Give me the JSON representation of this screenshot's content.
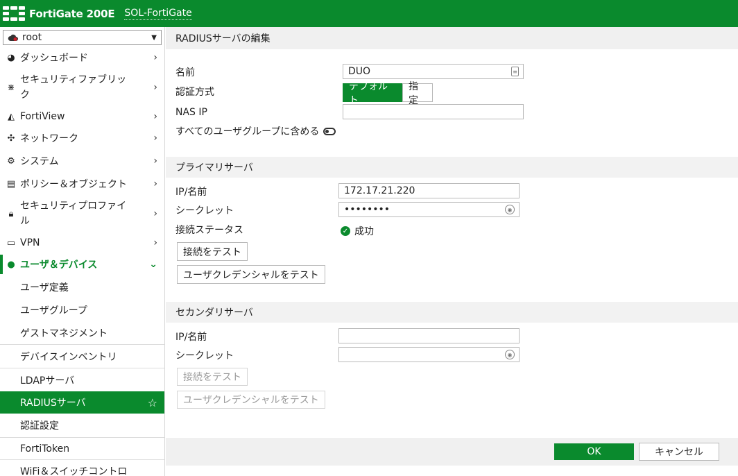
{
  "header": {
    "product": "FortiGate 200E",
    "hostname": "SOL-FortiGate"
  },
  "sidebar": {
    "vdom": "root",
    "items": [
      {
        "label": "ダッシュボード",
        "icon": "dashboard-icon"
      },
      {
        "label": "セキュリティファブリック",
        "icon": "fabric-icon"
      },
      {
        "label": "FortiView",
        "icon": "chart-icon"
      },
      {
        "label": "ネットワーク",
        "icon": "network-icon"
      },
      {
        "label": "システム",
        "icon": "gear-icon"
      },
      {
        "label": "ポリシー＆オブジェクト",
        "icon": "policy-icon"
      },
      {
        "label": "セキュリティプロファイル",
        "icon": "lock-icon"
      },
      {
        "label": "VPN",
        "icon": "monitor-icon"
      },
      {
        "label": "ユーザ＆デバイス",
        "icon": "user-icon"
      }
    ],
    "subitems": [
      {
        "label": "ユーザ定義"
      },
      {
        "label": "ユーザグループ"
      },
      {
        "label": "ゲストマネジメント"
      },
      {
        "label": "デバイスインベントリ"
      },
      {
        "label": "LDAPサーバ"
      },
      {
        "label": "RADIUSサーバ"
      },
      {
        "label": "認証設定"
      },
      {
        "label": "FortiToken"
      },
      {
        "label": "WiFi＆スイッチコントロ"
      }
    ]
  },
  "page": {
    "title": "RADIUSサーバの編集",
    "name_label": "名前",
    "name_value": "DUO",
    "auth_label": "認証方式",
    "auth_default": "デフォルト",
    "auth_specify": "指定",
    "nasip_label": "NAS IP",
    "nasip_value": "",
    "include_groups_label": "すべてのユーザグループに含める"
  },
  "primary": {
    "title": "プライマリサーバ",
    "ip_label": "IP/名前",
    "ip_value": "172.17.21.220",
    "secret_label": "シークレット",
    "secret_value": "••••••••",
    "status_label": "接続ステータス",
    "status_value": "成功",
    "test_conn": "接続をテスト",
    "test_cred": "ユーザクレデンシャルをテスト"
  },
  "secondary": {
    "title": "セカンダリサーバ",
    "ip_label": "IP/名前",
    "ip_value": "",
    "secret_label": "シークレット",
    "secret_value": "",
    "test_conn": "接続をテスト",
    "test_cred": "ユーザクレデンシャルをテスト"
  },
  "footer": {
    "ok": "OK",
    "cancel": "キャンセル"
  },
  "colors": {
    "brand": "#0a8a2d"
  }
}
